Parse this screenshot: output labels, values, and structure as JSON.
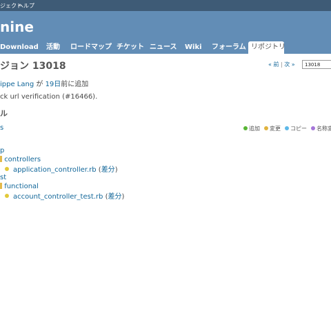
{
  "top_menu": {
    "items": [
      "ジェクト",
      "ヘルプ"
    ]
  },
  "header": {
    "title": "nine"
  },
  "main_menu": {
    "tabs": [
      {
        "label": "Download"
      },
      {
        "label": "活動"
      },
      {
        "label": "ロードマップ"
      },
      {
        "label": "チケット"
      },
      {
        "label": "ニュース"
      },
      {
        "label": "Wiki"
      },
      {
        "label": "フォーラム"
      },
      {
        "label": "リポジトリ",
        "selected": true
      }
    ]
  },
  "revision": {
    "title": "ジョン 13018",
    "nav_prev": "« 前",
    "nav_sep": "|",
    "nav_next": "次 »",
    "rev_value": "13018",
    "author_name": "ippe Lang",
    "author_mid": " が ",
    "time_ago": "19日",
    "author_suffix": "前に追加",
    "message": "ck url verification (#16466)."
  },
  "files": {
    "heading": "ル",
    "small_link": "s",
    "legend": [
      {
        "label": "追加",
        "color": "#58b535"
      },
      {
        "label": "変更",
        "color": "#e0b33f"
      },
      {
        "label": "コピー",
        "color": "#5db8e8"
      },
      {
        "label": "名称変",
        "color": "#a576d9"
      }
    ],
    "tree": [
      {
        "name": "p",
        "type": "folder"
      },
      {
        "name": "controllers",
        "type": "folder"
      },
      {
        "name": "application_controller.rb",
        "type": "file",
        "diff": "差分"
      },
      {
        "name": "st",
        "type": "folder"
      },
      {
        "name": "functional",
        "type": "folder"
      },
      {
        "name": "account_controller_test.rb",
        "type": "file",
        "diff": "差分"
      }
    ]
  }
}
